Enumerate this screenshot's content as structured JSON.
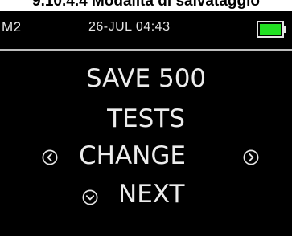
{
  "document": {
    "heading": "9.10.4.4 Modalità di salvataggio"
  },
  "device": {
    "status_bar": {
      "mode": "M2",
      "datetime": "26-JUL 04:43",
      "battery_color": "#22e022"
    },
    "main": {
      "line1": "SAVE 500",
      "line2": "TESTS"
    },
    "controls": {
      "change": {
        "label": "CHANGE",
        "left_icon": "chevron-left-circle-icon",
        "right_icon": "chevron-right-circle-icon"
      },
      "next": {
        "label": "NEXT",
        "icon": "chevron-down-circle-icon"
      }
    }
  }
}
